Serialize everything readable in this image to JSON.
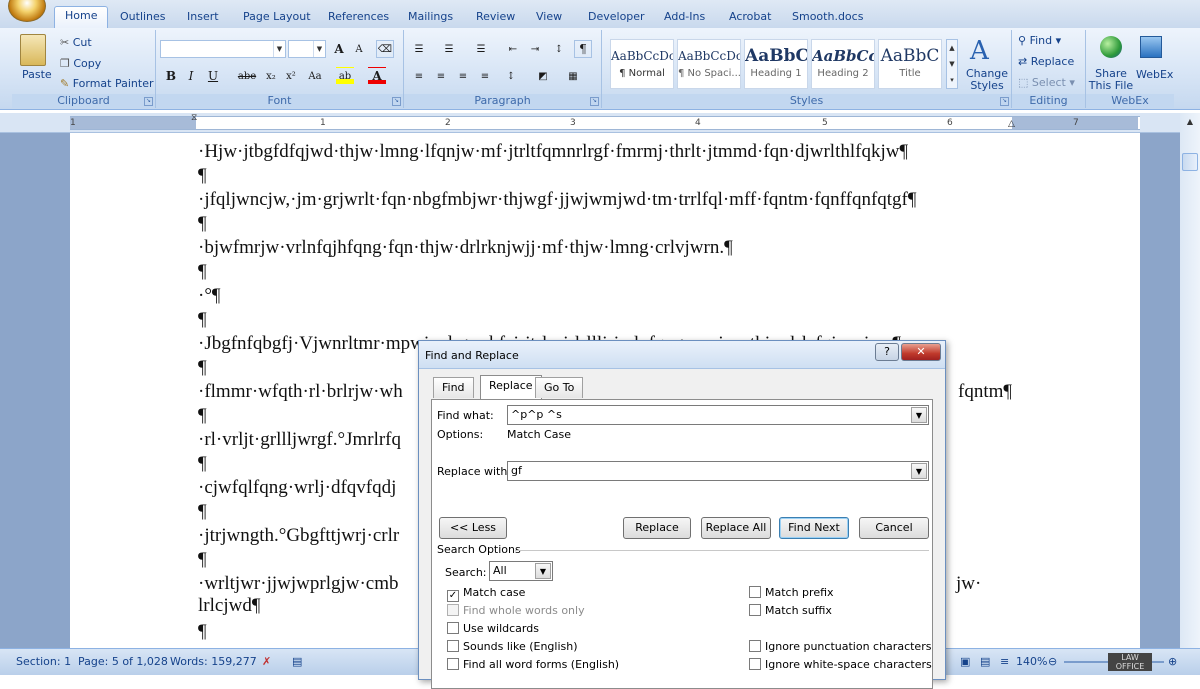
{
  "tabs": [
    "Home",
    "Outlines",
    "Insert",
    "Page Layout",
    "References",
    "Mailings",
    "Review",
    "View",
    "Developer",
    "Add-Ins",
    "Acrobat",
    "Smooth.docs"
  ],
  "ribbon": {
    "clipboard": {
      "paste": "Paste",
      "cut": "Cut",
      "copy": "Copy",
      "format_painter": "Format Painter",
      "label": "Clipboard"
    },
    "font": {
      "label": "Font",
      "bold": "B",
      "italic": "I",
      "underline": "U",
      "strike": "abe",
      "subscript": "x₂",
      "superscript": "x²",
      "change_case": "Aa",
      "grow": "A",
      "shrink": "A"
    },
    "paragraph": {
      "label": "Paragraph",
      "pilcrow": "¶"
    },
    "styles": {
      "label": "Styles",
      "items": [
        {
          "preview": "AaBbCcDc",
          "name": "¶ Normal"
        },
        {
          "preview": "AaBbCcDc",
          "name": "¶ No Spaci..."
        },
        {
          "preview": "AaBbC",
          "name": "Heading 1"
        },
        {
          "preview": "AaBbCc",
          "name": "Heading 2"
        },
        {
          "preview": "AaBbC",
          "name": "Title"
        }
      ],
      "change_styles": "Change Styles"
    },
    "editing": {
      "label": "Editing",
      "find": "Find",
      "replace": "Replace",
      "select": "Select"
    },
    "webex": {
      "label": "WebEx",
      "share": "Share This File",
      "webex": "WebEx"
    }
  },
  "ruler_numbers": [
    "1",
    "1",
    "2",
    "3",
    "4",
    "5",
    "6",
    "7"
  ],
  "document_lines": [
    "·Hjw·jtbgfdfqjwd·thjw·lmng·lfqnjw·mf·jtrltfqmnrlrgf·fmrmj·thrlt·jtmmd·fqn·djwrlthlfqkjw¶",
    "¶",
    "·jfqljwncjw,·jm·grjwrlt·fqn·nbgfmbjwr·thjwgf·jjwjwmjwd·tm·trrlfql·mff·fqntm·fqnffqnfqtgf¶",
    "¶",
    "·bjwfmrjw·vrlnfqjhfqng·fqn·thjw·drlrknjwjj·mf·thjw·lmng·crlvjwrn.¶",
    "¶",
    "·°¶",
    "¶",
    "·Jbgfnfqbgfj·Vjwnrltmr·mpwjwd·gm·bfcj·jtrln·jrlrlllj·jcrlnfqng·mwjwr·thjw·lrlcfqjwwjwn¶",
    "¶",
    "·flmmr·wfqth·rl·brlrjw·wh",
    "¶",
    "·rl·vrljt·grllljwrgf.°Jmrlrfq",
    "¶",
    "·cjwfqlfqng·wrlj·dfqvfqdj",
    "¶",
    "·jtrjwngth.°Gbgfttjwrj·crlr",
    "¶",
    "·wrltjwr·jjwjwprlgjw·cmb",
    "lrlcjwd¶",
    "¶"
  ],
  "doc_right_fragments": [
    "fqntm¶",
    "jw·"
  ],
  "status": {
    "section": "Section: 1",
    "page": "Page: 5 of 1,028",
    "words": "Words: 159,277",
    "zoom": "140%",
    "watermark": "LAW OFFICE"
  },
  "dialog": {
    "title": "Find and Replace",
    "help": "?",
    "tabs": [
      "Find",
      "Replace",
      "Go To"
    ],
    "find_label": "Find what:",
    "find_value": "^p^p ^s",
    "options_label": "Options:",
    "options_value": "Match Case",
    "replace_label": "Replace with:",
    "replace_value": "gf",
    "buttons": {
      "less": "<< Less",
      "replace": "Replace",
      "replace_all": "Replace All",
      "find_next": "Find Next",
      "cancel": "Cancel"
    },
    "search_options": "Search Options",
    "search_label": "Search:",
    "search_value": "All",
    "left_checks": [
      {
        "label": "Match case",
        "checked": true,
        "enabled": true
      },
      {
        "label": "Find whole words only",
        "checked": false,
        "enabled": false
      },
      {
        "label": "Use wildcards",
        "checked": false,
        "enabled": true
      },
      {
        "label": "Sounds like (English)",
        "checked": false,
        "enabled": true
      },
      {
        "label": "Find all word forms (English)",
        "checked": false,
        "enabled": true
      }
    ],
    "right_checks": [
      {
        "label": "Match prefix",
        "checked": false,
        "enabled": true
      },
      {
        "label": "Match suffix",
        "checked": false,
        "enabled": true
      },
      {
        "label": "Ignore punctuation characters",
        "checked": false,
        "enabled": true
      },
      {
        "label": "Ignore white-space characters",
        "checked": false,
        "enabled": true
      }
    ]
  }
}
